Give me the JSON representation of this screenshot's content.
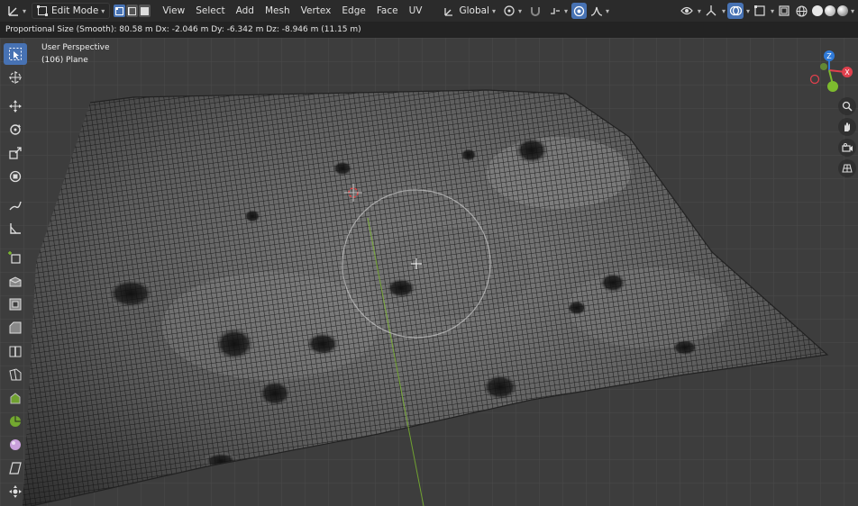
{
  "header": {
    "editor_type_icon": "axis-editor-icon",
    "mode_label": "Edit Mode",
    "select_modes": [
      "vertex-select-icon",
      "edge-select-icon",
      "face-select-icon"
    ],
    "menus": [
      "View",
      "Select",
      "Add",
      "Mesh",
      "Vertex",
      "Edge",
      "Face",
      "UV"
    ],
    "orientation_label": "Global",
    "right_icons": [
      "pivot-icon",
      "snap-icon",
      "proportional-icon",
      "falloff-icon",
      "visibility-icon",
      "gizmo-icon",
      "overlay-icon",
      "xray-icon",
      "wireframe-shading-icon",
      "solid-shading-icon",
      "material-shading-icon",
      "rendered-shading-icon"
    ]
  },
  "operator_bar": {
    "text": "Proportional Size (Smooth): 80.58 m   Dx: -2.046 m   Dy: -6.342 m   Dz: -8.946 m (11.15 m)"
  },
  "viewport": {
    "view_name": "User Perspective",
    "object_name": "(106) Plane"
  },
  "toolbar": {
    "tools": [
      "select-box-icon",
      "cursor-icon",
      "move-icon",
      "rotate-icon",
      "scale-icon",
      "transform-icon",
      "annotate-icon",
      "measure-icon",
      "add-cube-icon",
      "extrude-icon",
      "inset-icon",
      "bevel-icon",
      "loop-cut-icon",
      "knife-icon",
      "poly-build-icon",
      "spin-icon",
      "smooth-icon",
      "shear-icon",
      "shrink-fatten-icon"
    ]
  },
  "nav": {
    "axes": [
      "X",
      "Y",
      "Z"
    ],
    "buttons": [
      "zoom-icon",
      "pan-icon",
      "camera-icon",
      "perspective-toggle-icon"
    ]
  },
  "colors": {
    "accent": "#4772b3",
    "x_axis": "#e0404d",
    "y_axis": "#7dbb2e",
    "z_axis": "#2f7ad8",
    "viewport_bg": "#3d3d3d"
  }
}
